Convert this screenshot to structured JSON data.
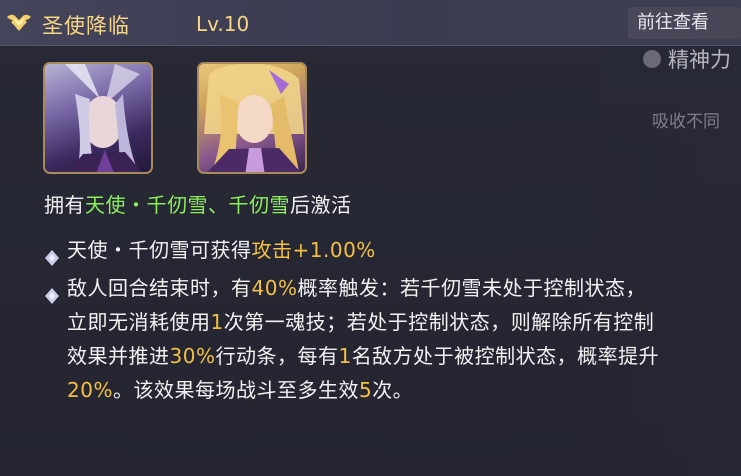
{
  "background": {
    "jingshen_text": "精神力",
    "xishou_text": "吸收不同"
  },
  "header": {
    "title": "圣使降临",
    "level": "Lv.10",
    "goto_button": "前往查看"
  },
  "portraits": [
    {
      "name": "portrait-1"
    },
    {
      "name": "portrait-2"
    }
  ],
  "activation": {
    "prefix": "拥有",
    "heroes": "天使・千仞雪、千仞雪",
    "suffix": "后激活"
  },
  "effects": {
    "e1": {
      "text_a": "天使・千仞雪可获得",
      "highlight": "攻击+1.00%"
    },
    "e2": {
      "t1": "敌人回合结束时，有",
      "h1": "40%",
      "t2": "概率触发：若千仞雪未处于控制状态，立即无消耗使用",
      "h2": "1",
      "t3": "次第一魂技；若处于控制状态，则解除所有控制效果并推进",
      "h3": "30%",
      "t4": "行动条，每有",
      "h4": "1",
      "t5": "名敌方处于被控制状态，概率提升",
      "h5": "20%",
      "t6": "。该效果每场战斗至多生效",
      "h6": "5",
      "t7": "次。"
    }
  },
  "colors": {
    "title_gold": "#f7d786",
    "hero_green": "#8cf05c",
    "value_gold": "#f2c042"
  }
}
